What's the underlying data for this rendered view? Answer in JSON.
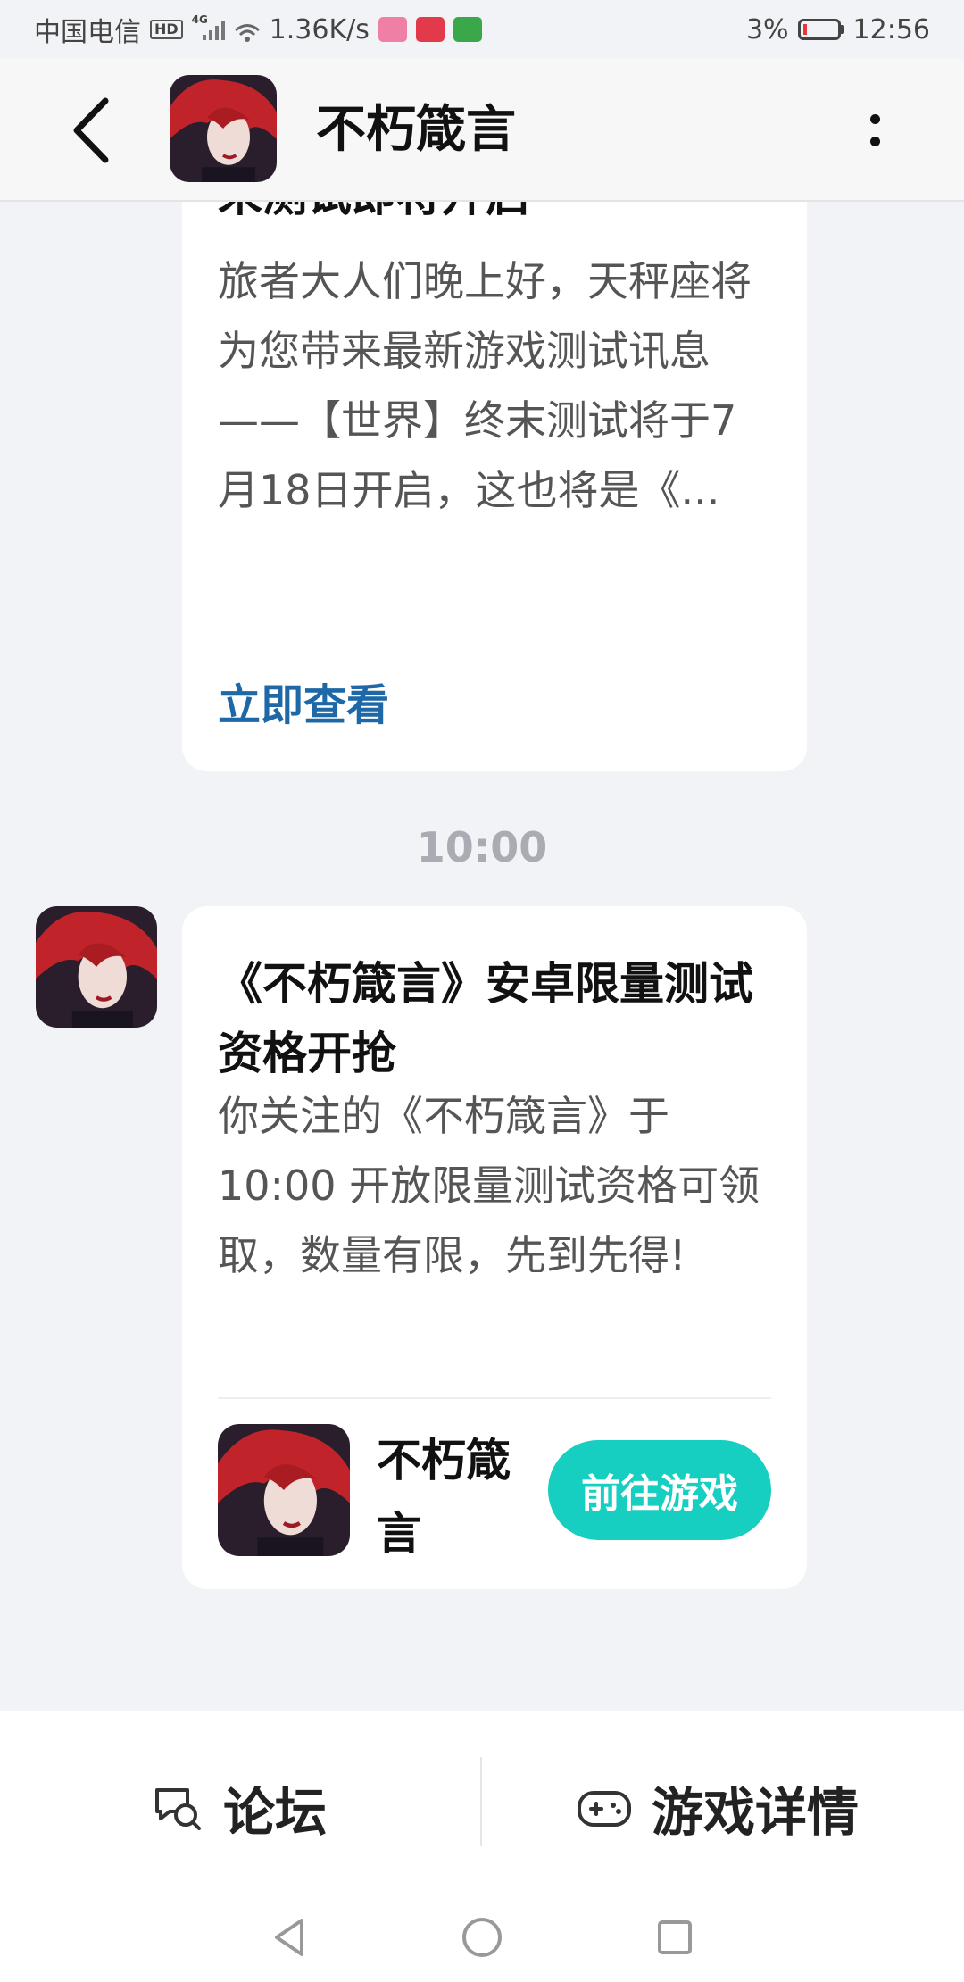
{
  "status_bar": {
    "carrier": "中国电信",
    "hd": "HD",
    "network": "4G",
    "speed": "1.36K/s",
    "battery": "3%",
    "time": "12:56"
  },
  "header": {
    "title": "不朽箴言"
  },
  "messages": [
    {
      "title_line2": "末测试即将开启",
      "body": "旅者大人们晚上好，天秤座将为您带来最新游戏测试讯息——【世界】终末测试将于7月18日开启，这也将是《...",
      "link": "立即查看"
    },
    {
      "time": "10:00",
      "title": "《不朽箴言》安卓限量测试资格开抢",
      "body": "你关注的《不朽箴言》于10:00 开放限量测试资格可领取，数量有限，先到先得!",
      "game_name": "不朽箴言",
      "button": "前往游戏"
    }
  ],
  "bottom_bar": {
    "forum": "论坛",
    "details": "游戏详情"
  },
  "colors": {
    "accent": "#16cfc0",
    "link": "#1e68a8",
    "background": "#f2f3f6"
  }
}
